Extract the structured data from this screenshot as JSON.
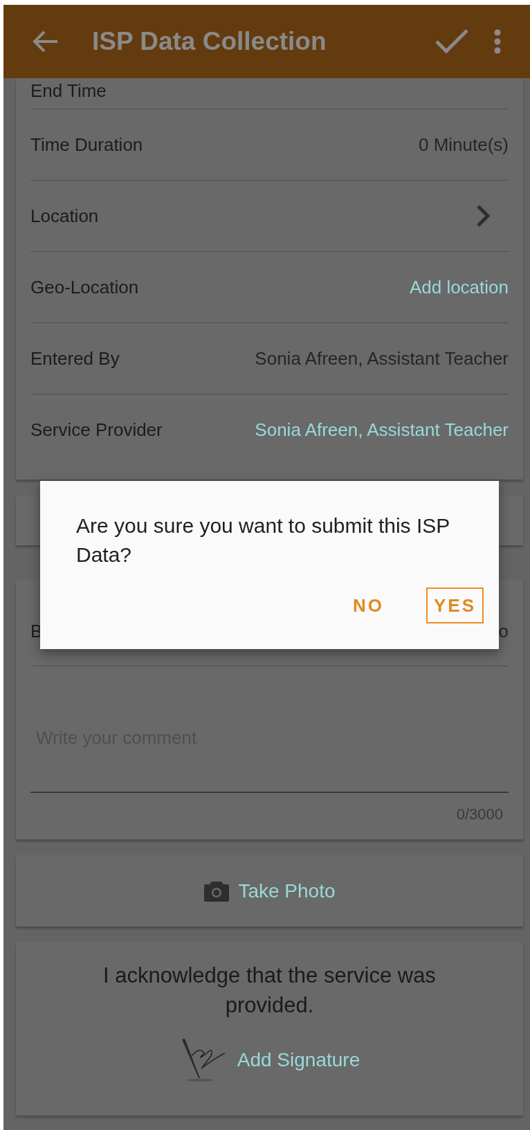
{
  "app_bar": {
    "title": "ISP Data Collection"
  },
  "details": [
    {
      "label": "End Time",
      "kind": "text"
    },
    {
      "label": "Time Duration",
      "value": "0 Minute(s)",
      "kind": "text"
    },
    {
      "label": "Location",
      "kind": "chevron"
    },
    {
      "label": "Geo-Location",
      "value": "Add location",
      "kind": "link"
    },
    {
      "label": "Entered By",
      "value": "Sonia Afreen, Assistant Teacher",
      "kind": "text"
    },
    {
      "label": "Service Provider",
      "value": "Sonia Afreen, Assistant Teacher",
      "kind": "link"
    }
  ],
  "comment_card": {
    "row": {
      "label": "B",
      "value": "o"
    },
    "comment": {
      "placeholder": "Write your comment",
      "counter": "0/3000"
    }
  },
  "photo": {
    "label": "Take Photo"
  },
  "signature": {
    "statement": "I acknowledge that the service was provided.",
    "label": "Add Signature"
  },
  "dialog": {
    "message": "Are you sure you want to submit this ISP Data?",
    "buttons": [
      {
        "label": "NO",
        "focused": false
      },
      {
        "label": "YES",
        "focused": true
      }
    ]
  }
}
